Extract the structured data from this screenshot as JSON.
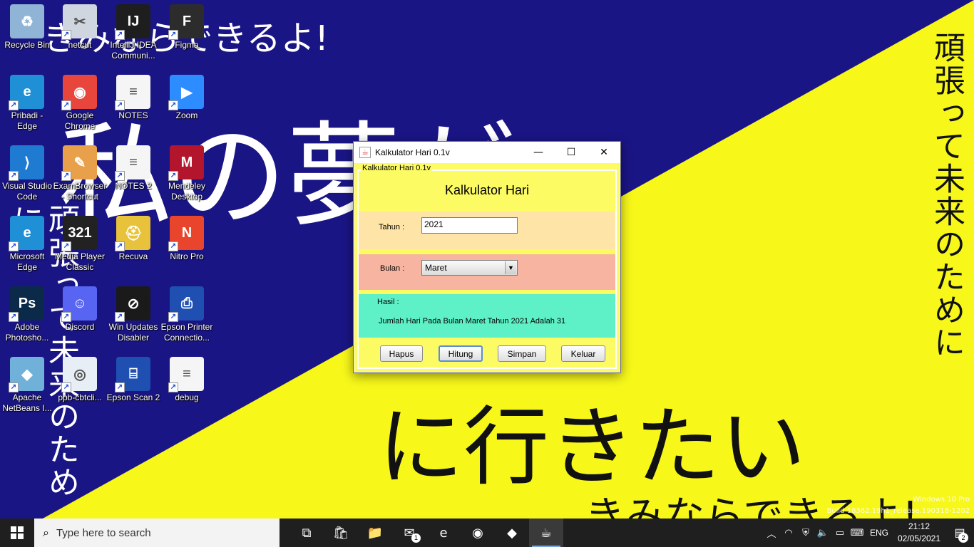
{
  "wallpaper": {
    "top_text": "きみならできるよ!",
    "big_text": "私の夢が",
    "bottom_text": "に行きたい",
    "bottom_text_2": "きみならできるよ!",
    "right_vertical": "頑張って未来のために",
    "left_vertical": "頑張って未来のために",
    "colors": {
      "blue": "#1a1585",
      "yellow": "#f7f71a"
    }
  },
  "watermark": {
    "line1": "Windows 10 Pro",
    "line2": "Build 18362.19h1_release.190318-1202"
  },
  "desktop_icons": [
    {
      "label": "Recycle Bin",
      "icon": "recycle-bin-icon",
      "color": "#8fb4d6",
      "glyph": "♻"
    },
    {
      "label": "netcut",
      "icon": "netcut-icon",
      "color": "#cfd6e0",
      "glyph": "✂"
    },
    {
      "label": "IntelliJ IDEA Communi...",
      "icon": "intellij-icon",
      "color": "#1e1e1e",
      "glyph": "IJ"
    },
    {
      "label": "Figma",
      "icon": "figma-icon",
      "color": "#2c2c2c",
      "glyph": "F"
    },
    {
      "label": "Pribadi - Edge",
      "icon": "edge-icon",
      "color": "#1f8fd6",
      "glyph": "e"
    },
    {
      "label": "Google Chrome",
      "icon": "chrome-icon",
      "color": "#e8453c",
      "glyph": "◉"
    },
    {
      "label": "NOTES",
      "icon": "text-file-icon",
      "color": "#f5f5f5",
      "glyph": "≡"
    },
    {
      "label": "Zoom",
      "icon": "zoom-icon",
      "color": "#2d8cff",
      "glyph": "▶"
    },
    {
      "label": "Visual Studio Code",
      "icon": "vscode-icon",
      "color": "#1f7ad1",
      "glyph": "⟩"
    },
    {
      "label": "ExamBrowser - Shortcut",
      "icon": "exambrowser-icon",
      "color": "#e8a04a",
      "glyph": "✎"
    },
    {
      "label": "NOTES 2",
      "icon": "text-file-icon",
      "color": "#f5f5f5",
      "glyph": "≡"
    },
    {
      "label": "Mendeley Desktop",
      "icon": "mendeley-icon",
      "color": "#b3162c",
      "glyph": "M"
    },
    {
      "label": "Microsoft Edge",
      "icon": "edge-icon",
      "color": "#1f8fd6",
      "glyph": "e"
    },
    {
      "label": "Media Player Classic",
      "icon": "media-player-icon",
      "color": "#222",
      "glyph": "321"
    },
    {
      "label": "Recuva",
      "icon": "recuva-icon",
      "color": "#e8c23a",
      "glyph": "⛑"
    },
    {
      "label": "Nitro Pro",
      "icon": "nitro-icon",
      "color": "#e8452c",
      "glyph": "N"
    },
    {
      "label": "Adobe Photosho...",
      "icon": "photoshop-icon",
      "color": "#0b2a4a",
      "glyph": "Ps"
    },
    {
      "label": "Discord",
      "icon": "discord-icon",
      "color": "#5865f2",
      "glyph": "☺"
    },
    {
      "label": "Win Updates Disabler",
      "icon": "win-updates-disabler-icon",
      "color": "#1a1a1a",
      "glyph": "⊘"
    },
    {
      "label": "Epson Printer Connectio...",
      "icon": "epson-printer-icon",
      "color": "#1f4fb0",
      "glyph": "⎙"
    },
    {
      "label": "Apache NetBeans I...",
      "icon": "netbeans-icon",
      "color": "#6fb1d8",
      "glyph": "◆"
    },
    {
      "label": "ppb-cbtcli...",
      "icon": "ppb-cbt-icon",
      "color": "#e8eef5",
      "glyph": "◎"
    },
    {
      "label": "Epson Scan 2",
      "icon": "epson-scan-icon",
      "color": "#1f4fb0",
      "glyph": "⌸"
    },
    {
      "label": "debug",
      "icon": "text-file-icon",
      "color": "#f5f5f5",
      "glyph": "≡"
    }
  ],
  "window": {
    "title": "Kalkulator Hari 0.1v",
    "group_title": "Kalkulator Hari 0.1v",
    "heading": "Kalkulator Hari",
    "tahun_label": "Tahun :",
    "tahun_value": "2021",
    "bulan_label": "Bulan :",
    "bulan_value": "Maret",
    "hasil_label": "Hasil :",
    "hasil_text": "Jumlah Hari Pada Bulan Maret Tahun 2021 Adalah 31",
    "buttons": {
      "hapus": "Hapus",
      "hitung": "Hitung",
      "simpan": "Simpan",
      "keluar": "Keluar"
    },
    "colors": {
      "panel": "#fcfb63",
      "tahun_band": "#ffe4a8",
      "bulan_band": "#f7b4a0",
      "hasil_band": "#5ef0c6"
    }
  },
  "taskbar": {
    "search_placeholder": "Type here to search",
    "apps": [
      {
        "name": "task-view-icon",
        "glyph": "⧉"
      },
      {
        "name": "microsoft-store-icon",
        "glyph": "🛍"
      },
      {
        "name": "file-explorer-icon",
        "glyph": "📁"
      },
      {
        "name": "mail-icon",
        "glyph": "✉",
        "badge": "1"
      },
      {
        "name": "edge-icon",
        "glyph": "e"
      },
      {
        "name": "chrome-icon",
        "glyph": "◉"
      },
      {
        "name": "netbeans-icon",
        "glyph": "◆"
      },
      {
        "name": "java-icon",
        "glyph": "☕",
        "active": true
      }
    ],
    "language": "ENG",
    "time": "21:12",
    "date": "02/05/2021",
    "notification_count": "2"
  }
}
